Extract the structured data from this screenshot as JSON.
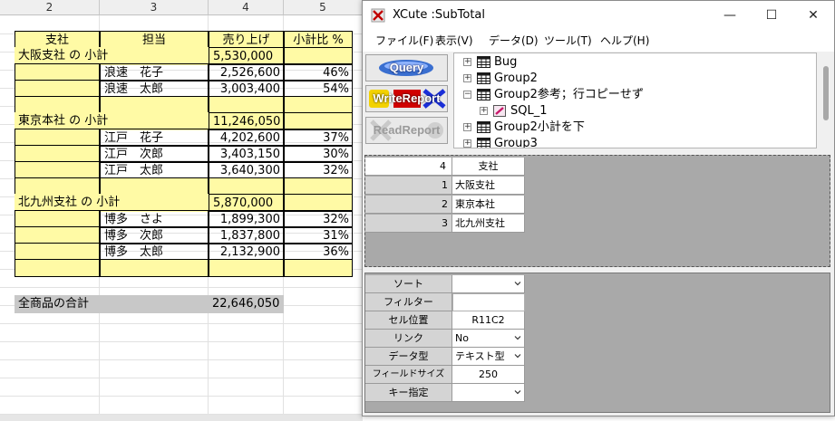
{
  "spreadsheet": {
    "column_headers": [
      "2",
      "3",
      "4",
      "5"
    ],
    "table_headers": [
      "支社",
      "担当",
      "売り上げ",
      "小計比 %"
    ],
    "rows": [
      {
        "type": "subtotal",
        "label": "大阪支社 の 小計",
        "amount": "5,530,000"
      },
      {
        "type": "detail",
        "person": "浪速　花子",
        "amount": "2,526,600",
        "ratio": "46%"
      },
      {
        "type": "detail",
        "person": "浪速　太郎",
        "amount": "3,003,400",
        "ratio": "54%"
      },
      {
        "type": "blank"
      },
      {
        "type": "subtotal",
        "label": "東京本社 の 小計",
        "amount": "11,246,050"
      },
      {
        "type": "detail",
        "person": "江戸　花子",
        "amount": "4,202,600",
        "ratio": "37%"
      },
      {
        "type": "detail",
        "person": "江戸　次郎",
        "amount": "3,403,150",
        "ratio": "30%"
      },
      {
        "type": "detail",
        "person": "江戸　太郎",
        "amount": "3,640,300",
        "ratio": "32%"
      },
      {
        "type": "blank"
      },
      {
        "type": "subtotal",
        "label": "北九州支社 の 小計",
        "amount": "5,870,000"
      },
      {
        "type": "detail",
        "person": "博多　さよ",
        "amount": "1,899,300",
        "ratio": "32%"
      },
      {
        "type": "detail",
        "person": "博多　次郎",
        "amount": "1,837,800",
        "ratio": "31%"
      },
      {
        "type": "detail",
        "person": "博多　太郎",
        "amount": "2,132,900",
        "ratio": "36%"
      },
      {
        "type": "blank"
      }
    ],
    "grand_total": {
      "label": "全商品の合計",
      "amount": "22,646,050"
    },
    "colors": {
      "highlight": "#fffaa5",
      "total": "#c8c8c8"
    }
  },
  "window": {
    "title": "XCute :SubTotal",
    "controls": {
      "minimize": "—",
      "maximize": "☐",
      "close": "✕"
    },
    "menu": [
      "ファイル(F)",
      "表示(V)",
      "データ(D)",
      "ツール(T)",
      "ヘルプ(H)"
    ],
    "toolbar": [
      "Query",
      "WriteReport",
      "ReadReport"
    ],
    "tree": [
      {
        "label": "Bug",
        "icon": "table-icon",
        "expander": "+",
        "indent": 0
      },
      {
        "label": "Group2",
        "icon": "table-icon",
        "expander": "+",
        "indent": 0
      },
      {
        "label": "Group2参考；行コピーせず",
        "icon": "table-icon",
        "expander": "−",
        "indent": 0
      },
      {
        "label": "SQL_1",
        "icon": "sql-icon",
        "expander": "+",
        "indent": 1
      },
      {
        "label": "Group2小計を下",
        "icon": "table-icon",
        "expander": "+",
        "indent": 0
      },
      {
        "label": "Group3",
        "icon": "table-icon",
        "expander": "+",
        "indent": 0
      }
    ],
    "grid1": {
      "header": {
        "index": "4",
        "value": "支社"
      },
      "rows": [
        {
          "index": "1",
          "value": "大阪支社"
        },
        {
          "index": "2",
          "value": "東京本社"
        },
        {
          "index": "3",
          "value": "北九州支社"
        }
      ]
    },
    "properties": [
      {
        "label": "ソート",
        "value": "",
        "kind": "dropdown"
      },
      {
        "label": "フィルター",
        "value": "",
        "kind": "input"
      },
      {
        "label": "セル位置",
        "value": "R11C2",
        "kind": "text"
      },
      {
        "label": "リンク",
        "value": "No",
        "kind": "dropdown"
      },
      {
        "label": "データ型",
        "value": "テキスト型",
        "kind": "dropdown"
      },
      {
        "label": "フィールドサイズ",
        "value": "250",
        "kind": "text"
      },
      {
        "label": "キー指定",
        "value": "",
        "kind": "dropdown"
      }
    ]
  }
}
